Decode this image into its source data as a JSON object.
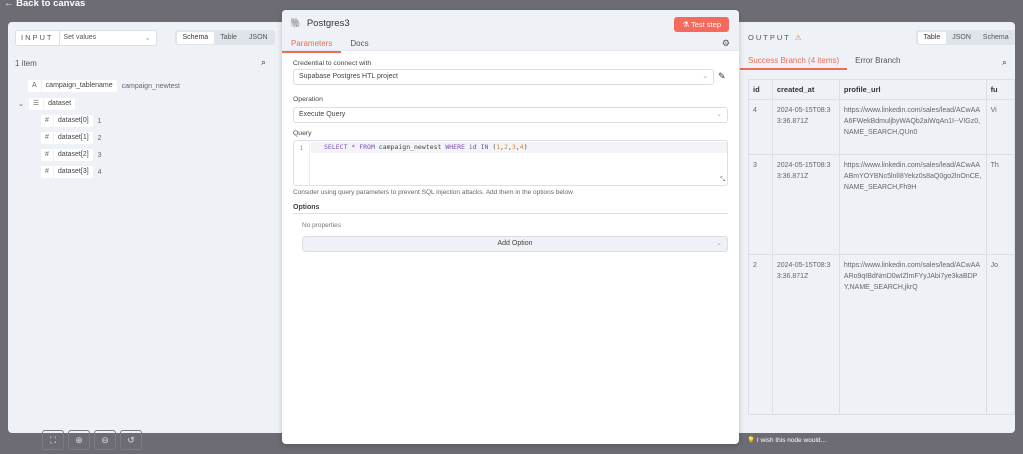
{
  "back_label": "Back to canvas",
  "input": {
    "label": "INPUT",
    "node": "Set values",
    "views": [
      "Schema",
      "Table",
      "JSON"
    ],
    "active_view": "Schema",
    "count": "1 item",
    "fields": [
      {
        "type": "A",
        "name": "campaign_tablename",
        "value": "campaign_newtest"
      },
      {
        "type": "list",
        "name": "dataset",
        "value": ""
      }
    ],
    "dataset": [
      {
        "name": "dataset[0]",
        "value": "1"
      },
      {
        "name": "dataset[1]",
        "value": "2"
      },
      {
        "name": "dataset[2]",
        "value": "3"
      },
      {
        "name": "dataset[3]",
        "value": "4"
      }
    ]
  },
  "node": {
    "title": "Postgres3",
    "test_label": "Test step",
    "tabs": [
      "Parameters",
      "Docs"
    ],
    "active_tab": "Parameters",
    "credential_label": "Credential to connect with",
    "credential": "Supabase Postgres HTL project",
    "operation_label": "Operation",
    "operation": "Execute Query",
    "query_label": "Query",
    "line_no": "1",
    "query": {
      "k1": "SELECT",
      "op": " * ",
      "k2": "FROM",
      "t": " campaign_newtest ",
      "k3": "WHERE",
      "k4": " id",
      "k5": " IN",
      "p1": " (",
      "n1": "1",
      ",": ",",
      "n2": "2",
      "n3": "3",
      "n4": "4",
      "p2": ")"
    },
    "hint": "Consider using query parameters to prevent SQL injection attacks. Add them in the options below",
    "options_label": "Options",
    "no_props": "No properties",
    "add_option": "Add Option"
  },
  "output": {
    "label": "OUTPUT",
    "views": [
      "Table",
      "JSON",
      "Schema"
    ],
    "active_view": "Table",
    "tabs": [
      "Success Branch (4 items)",
      "Error Branch"
    ],
    "columns": [
      "id",
      "created_at",
      "profile_url",
      "fu"
    ],
    "rows": [
      {
        "id": "4",
        "created_at": "2024-05-15T08:33:36.871Z",
        "profile_url": "https://www.linkedin.com/sales/lead/ACwAAA6FWekBdmuljbyWAQb2aiWqAn1I--VIGz0,NAME_SEARCH,QUn0",
        "fu": "Vi"
      },
      {
        "id": "3",
        "created_at": "2024-05-15T08:33:36.871Z",
        "profile_url": "https://www.linkedin.com/sales/lead/ACwAAABmYOYBNc5lnlI8Yekz0s8aQ0go2lnOnCE,NAME_SEARCH,Fh9H",
        "fu": "Th"
      },
      {
        "id": "2",
        "created_at": "2024-05-15T08:33:36.871Z",
        "profile_url": "https://www.linkedin.com/sales/lead/ACwAAARo9qIBdNmD0wIZlmFYyJAbi7ye3kaBDPY,NAME_SEARCH,jkrQ",
        "fu": "Jo"
      }
    ]
  },
  "feedback": "I wish this node would..."
}
